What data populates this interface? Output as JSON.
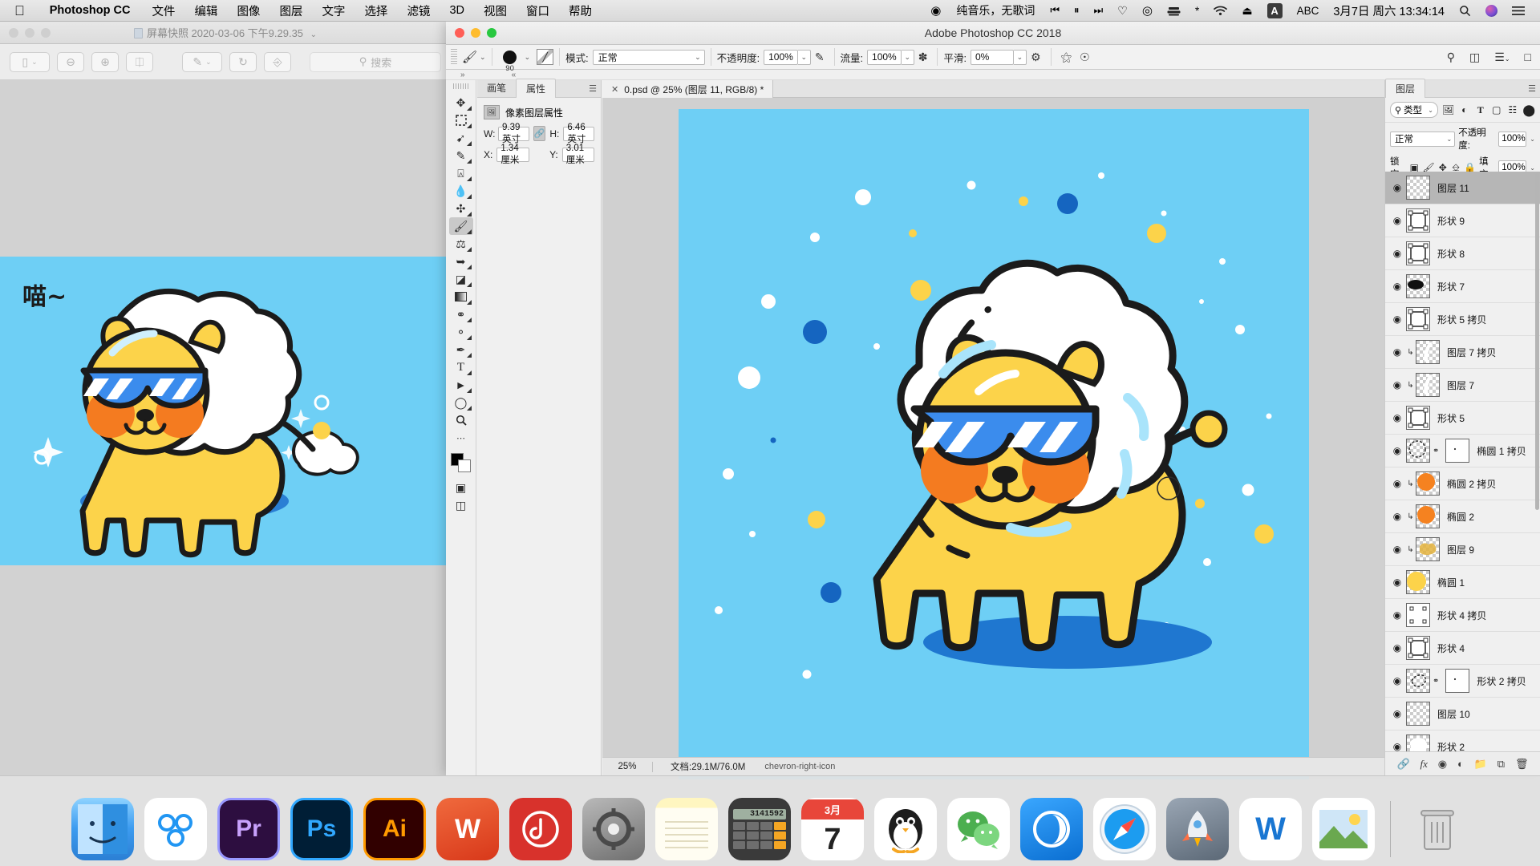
{
  "menubar": {
    "apple_icon": "apple-logo",
    "app_name": "Photoshop CC",
    "items": [
      "文件",
      "编辑",
      "图像",
      "图层",
      "文字",
      "选择",
      "滤镜",
      "3D",
      "视图",
      "窗口",
      "帮助"
    ],
    "record_icon": "record-icon",
    "music_text": "纯音乐，无歌词",
    "media_icons": [
      "prev-track-icon",
      "pause-icon",
      "next-track-icon",
      "heart-icon",
      "airplay-target-icon",
      "display-icon",
      "bluetooth-icon",
      "wifi-icon",
      "eject-icon"
    ],
    "input_badge": "A",
    "input_label": "ABC",
    "datetime": "3月7日 周六  13:34:14",
    "search_icon": "search-icon",
    "siri_icon": "siri-icon",
    "control_center_icon": "control-center-icon"
  },
  "bg_window": {
    "title": "屏幕快照 2020-03-06 下午9.29.35",
    "title_caret": "chevron-down-icon",
    "doc_icon": "document-icon",
    "toolbar": [
      {
        "name": "sidebar-toggle-button",
        "glyph": "▥",
        "caret": true
      },
      {
        "name": "zoom-out-button",
        "glyph": "⊖",
        "caret": false
      },
      {
        "name": "zoom-in-button",
        "glyph": "⊕",
        "caret": false
      },
      {
        "name": "share-button",
        "glyph": "↑",
        "caret": false
      },
      {
        "name": "markup-button",
        "glyph": "✎",
        "caret": true
      },
      {
        "name": "rotate-button",
        "glyph": "⟲",
        "caret": false
      },
      {
        "name": "toolkit-button",
        "glyph": "🧰",
        "caret": false
      }
    ],
    "search_placeholder": "搜索",
    "artwork_caption": "喵~"
  },
  "photoshop": {
    "window_title": "Adobe Photoshop CC 2018",
    "options_bar": {
      "tool_icon": "brush-tool-icon",
      "brush_size": "90",
      "brush_preset_icon": "brush-preset-icon",
      "toggle_panel_icon": "brush-panel-icon",
      "mode_label": "模式:",
      "mode_value": "正常",
      "opacity_label": "不透明度:",
      "opacity_value": "100%",
      "pressure_opacity_icon": "pressure-opacity-icon",
      "flow_label": "流量:",
      "flow_value": "100%",
      "airbrush_icon": "airbrush-icon",
      "smoothing_label": "平滑:",
      "smoothing_value": "0%",
      "smoothing_options_icon": "gear-icon",
      "symmetry_icon": "symmetry-icon",
      "pressure_size_icon": "pressure-size-icon",
      "right_icons": [
        "search-icon",
        "workspace-icon",
        "arrange-icon",
        "share-icon"
      ]
    },
    "collapse_left": "»",
    "collapse_right": "«",
    "tools": [
      {
        "name": "move-tool",
        "glyph": "✥",
        "selected": false,
        "corner": true
      },
      {
        "name": "marquee-tool",
        "glyph": "▭",
        "selected": false,
        "corner": true
      },
      {
        "name": "lasso-tool",
        "glyph": "𝓛",
        "selected": false,
        "corner": true
      },
      {
        "name": "quick-selection-tool",
        "glyph": "✐",
        "selected": false,
        "corner": true
      },
      {
        "name": "crop-tool",
        "glyph": "⌗",
        "selected": false,
        "corner": true
      },
      {
        "name": "eyedropper-tool",
        "glyph": "✒",
        "selected": false,
        "corner": true
      },
      {
        "name": "healing-brush-tool",
        "glyph": "✣",
        "selected": false,
        "corner": true
      },
      {
        "name": "brush-tool",
        "glyph": "🖌",
        "selected": true,
        "corner": true
      },
      {
        "name": "clone-stamp-tool",
        "glyph": "⚲",
        "selected": false,
        "corner": true
      },
      {
        "name": "history-brush-tool",
        "glyph": "↯",
        "selected": false,
        "corner": true
      },
      {
        "name": "eraser-tool",
        "glyph": "◪",
        "selected": false,
        "corner": true
      },
      {
        "name": "gradient-tool",
        "glyph": "▤",
        "selected": false,
        "corner": true
      },
      {
        "name": "blur-tool",
        "glyph": "💧",
        "selected": false,
        "corner": true
      },
      {
        "name": "dodge-tool",
        "glyph": "◐",
        "selected": false,
        "corner": true
      },
      {
        "name": "pen-tool",
        "glyph": "✑",
        "selected": false,
        "corner": true
      },
      {
        "name": "type-tool",
        "glyph": "T",
        "selected": false,
        "corner": true
      },
      {
        "name": "path-selection-tool",
        "glyph": "➤",
        "selected": false,
        "corner": true
      },
      {
        "name": "ellipse-tool",
        "glyph": "◯",
        "selected": false,
        "corner": true
      },
      {
        "name": "zoom-tool",
        "glyph": "🔍",
        "selected": false,
        "corner": false
      },
      {
        "name": "more-tools",
        "glyph": "•••",
        "selected": false,
        "corner": false
      },
      {
        "name": "screen-mode-tool",
        "glyph": "⇄",
        "selected": false,
        "corner": false
      }
    ],
    "properties_panel": {
      "tabs": [
        {
          "label": "画笔",
          "active": false
        },
        {
          "label": "属性",
          "active": true
        }
      ],
      "menu_icon": "panel-menu-icon",
      "header_label": "像素图层属性",
      "header_icon": "pixel-layer-icon",
      "w_label": "W:",
      "w_value": "9.39 英寸",
      "link_icon": "link-icon",
      "h_label": "H:",
      "h_value": "6.46 英寸",
      "x_label": "X:",
      "x_value": "1.34 厘米",
      "y_label": "Y:",
      "y_value": "3.01 厘米"
    },
    "document": {
      "tab_close_icon": "close-icon",
      "tab_title": "0.psd @ 25% (图层 11, RGB/8) *",
      "zoom": "25%",
      "status": "文档:29.1M/76.0M",
      "status_arrow": "chevron-right-icon"
    },
    "layers_panel": {
      "tab_label": "图层",
      "menu_icon": "panel-menu-icon",
      "filter_type_label": "类型",
      "filter_search_icon": "search-icon",
      "filter_caret": "chevron-down-icon",
      "filter_icons": [
        "pixel-filter-icon",
        "adjustment-filter-icon",
        "type-filter-icon",
        "shape-filter-icon",
        "smart-object-filter-icon"
      ],
      "filter_toggle_icon": "filter-toggle-icon",
      "blend_mode": "正常",
      "opacity_label": "不透明度:",
      "opacity_value": "100%",
      "lock_label": "锁定:",
      "lock_icons": [
        "lock-transparency-icon",
        "lock-image-icon",
        "lock-position-icon",
        "lock-artboard-icon",
        "lock-all-icon"
      ],
      "fill_label": "填充:",
      "fill_value": "100%",
      "layers": [
        {
          "name": "图层 11",
          "kind": "pixel",
          "selected": true,
          "clipped": false,
          "mask": false,
          "thumb": "transparent"
        },
        {
          "name": "形状 9",
          "kind": "shape",
          "selected": false,
          "clipped": false,
          "mask": false,
          "thumb": "vector"
        },
        {
          "name": "形状 8",
          "kind": "shape",
          "selected": false,
          "clipped": false,
          "mask": false,
          "thumb": "vector"
        },
        {
          "name": "形状 7",
          "kind": "shape",
          "selected": false,
          "clipped": false,
          "mask": false,
          "thumb": "black-blob"
        },
        {
          "name": "形状 5 拷贝",
          "kind": "shape",
          "selected": false,
          "clipped": false,
          "mask": false,
          "thumb": "vector"
        },
        {
          "name": "图层 7 拷贝",
          "kind": "pixel",
          "selected": false,
          "clipped": true,
          "mask": false,
          "thumb": "white-streak"
        },
        {
          "name": "图层 7",
          "kind": "pixel",
          "selected": false,
          "clipped": true,
          "mask": false,
          "thumb": "white-streak"
        },
        {
          "name": "形状 5",
          "kind": "shape",
          "selected": false,
          "clipped": false,
          "mask": false,
          "thumb": "vector"
        },
        {
          "name": "椭圆 1 拷贝",
          "kind": "shape",
          "selected": false,
          "clipped": false,
          "mask": true,
          "thumb": "dotted-circle"
        },
        {
          "name": "椭圆 2 拷贝",
          "kind": "shape",
          "selected": false,
          "clipped": true,
          "mask": false,
          "thumb": "orange-circle"
        },
        {
          "name": "椭圆 2",
          "kind": "shape",
          "selected": false,
          "clipped": true,
          "mask": false,
          "thumb": "orange-circle"
        },
        {
          "name": "图层 9",
          "kind": "pixel",
          "selected": false,
          "clipped": true,
          "mask": false,
          "thumb": "gold-swirl"
        },
        {
          "name": "椭圆 1",
          "kind": "shape",
          "selected": false,
          "clipped": false,
          "mask": false,
          "thumb": "yellow-circle"
        },
        {
          "name": "形状 4 拷贝",
          "kind": "shape",
          "selected": false,
          "clipped": false,
          "mask": false,
          "thumb": "empty-vector"
        },
        {
          "name": "形状 4",
          "kind": "shape",
          "selected": false,
          "clipped": false,
          "mask": false,
          "thumb": "vector"
        },
        {
          "name": "形状 2 拷贝",
          "kind": "shape",
          "selected": false,
          "clipped": false,
          "mask": true,
          "thumb": "dotted-shape"
        },
        {
          "name": "图层 10",
          "kind": "pixel",
          "selected": false,
          "clipped": false,
          "mask": false,
          "thumb": "transparent"
        },
        {
          "name": "形状 2",
          "kind": "shape",
          "selected": false,
          "clipped": false,
          "mask": false,
          "thumb": "white-shape"
        }
      ],
      "footer_icons": [
        "link-layers-icon",
        "layer-style-icon",
        "layer-mask-icon",
        "adjustment-layer-icon",
        "new-group-icon",
        "new-layer-icon",
        "delete-layer-icon"
      ]
    }
  },
  "dock": {
    "items": [
      {
        "name": "finder",
        "label": "Finder",
        "color": "#2196f3",
        "glyph": "☺",
        "running": true
      },
      {
        "name": "cloud-app",
        "label": "Creative Cloud",
        "color": "#ffffff",
        "glyph": "◉",
        "running": true
      },
      {
        "name": "premiere-pro",
        "label": "Pr",
        "color": "#2d0e40",
        "glyph": "Pr",
        "running": false
      },
      {
        "name": "photoshop",
        "label": "Ps",
        "color": "#001e36",
        "glyph": "Ps",
        "running": true
      },
      {
        "name": "illustrator",
        "label": "Ai",
        "color": "#310000",
        "glyph": "Ai",
        "running": false
      },
      {
        "name": "wps-office",
        "label": "W",
        "color": "#d94f2b",
        "glyph": "W",
        "running": false
      },
      {
        "name": "netease-music",
        "label": "网易云音乐",
        "color": "#d8322c",
        "glyph": "♪",
        "running": true
      },
      {
        "name": "system-preferences",
        "label": "系统偏好设置",
        "color": "#8a8a8a",
        "glyph": "⚙",
        "running": false
      },
      {
        "name": "notes",
        "label": "备忘录",
        "color": "#fdf6c8",
        "glyph": "▤",
        "running": false
      },
      {
        "name": "calculator",
        "label": "计算器",
        "color": "#3a3a3a",
        "glyph": "⌨",
        "running": false
      },
      {
        "name": "calendar",
        "label": "日历",
        "color": "#ffffff",
        "glyph": "7",
        "running": false
      },
      {
        "name": "qq",
        "label": "QQ",
        "color": "#ffffff",
        "glyph": "🐧",
        "running": true
      },
      {
        "name": "wechat",
        "label": "微信",
        "color": "#ffffff",
        "glyph": "💬",
        "running": true
      },
      {
        "name": "qq-browser",
        "label": "QQ浏览器",
        "color": "#1f8df5",
        "glyph": "◑",
        "running": false
      },
      {
        "name": "safari",
        "label": "Safari",
        "color": "#ffffff",
        "glyph": "🧭",
        "running": false
      },
      {
        "name": "launchpad",
        "label": "Launchpad",
        "color": "#6f7b8a",
        "glyph": "🚀",
        "running": false
      },
      {
        "name": "wondershare",
        "label": "W",
        "color": "#ffffff",
        "glyph": "W",
        "running": false
      },
      {
        "name": "photos",
        "label": "照片",
        "color": "#ffffff",
        "glyph": "🌄",
        "running": false
      },
      {
        "name": "trash",
        "label": "废纸篓",
        "color": "#d9d9d9",
        "glyph": "🗑",
        "running": false
      }
    ],
    "calendar_month": "3月",
    "calendar_day": "7",
    "calculator_display": "3141592"
  },
  "artwork": {
    "bg_color": "#6ecff5",
    "body_color": "#fcd34a",
    "body_dark": "#f5c330",
    "mane_color": "#ffffff",
    "shadow_color": "#2a7fd4",
    "glasses_color": "#3b8ced",
    "cheek_color": "#f47b20",
    "outline_color": "#1b1b1b",
    "confetti_colors": [
      "#ffffff",
      "#2a7fd4",
      "#fcd34a",
      "#1565c0"
    ]
  }
}
